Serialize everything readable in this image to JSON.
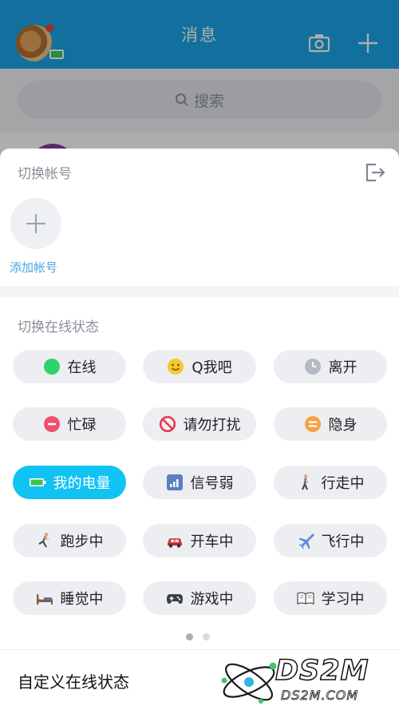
{
  "header": {
    "title": "消息"
  },
  "search": {
    "placeholder": "搜索"
  },
  "account_section": {
    "title": "切换帐号",
    "add_label": "添加帐号"
  },
  "status_section": {
    "title": "切换在线状态",
    "items": [
      {
        "label": "在线",
        "icon": "green-dot-icon",
        "active": false
      },
      {
        "label": "Q我吧",
        "icon": "smile-face-icon",
        "active": false
      },
      {
        "label": "离开",
        "icon": "clock-icon",
        "active": false
      },
      {
        "label": "忙碌",
        "icon": "minus-circle-icon",
        "active": false
      },
      {
        "label": "请勿打扰",
        "icon": "no-entry-icon",
        "active": false
      },
      {
        "label": "隐身",
        "icon": "equals-circle-icon",
        "active": false
      },
      {
        "label": "我的电量",
        "icon": "battery-icon",
        "active": true
      },
      {
        "label": "信号弱",
        "icon": "signal-icon",
        "active": false
      },
      {
        "label": "行走中",
        "icon": "walking-icon",
        "active": false
      },
      {
        "label": "跑步中",
        "icon": "running-icon",
        "active": false
      },
      {
        "label": "开车中",
        "icon": "car-icon",
        "active": false
      },
      {
        "label": "飞行中",
        "icon": "airplane-icon",
        "active": false
      },
      {
        "label": "睡觉中",
        "icon": "bed-icon",
        "active": false
      },
      {
        "label": "游戏中",
        "icon": "gamepad-icon",
        "active": false
      },
      {
        "label": "学习中",
        "icon": "book-icon",
        "active": false
      }
    ]
  },
  "pager": {
    "page_index": 1,
    "page_count": 2
  },
  "footer": {
    "custom_status_label": "自定义在线状态"
  },
  "watermark": {
    "text": "DS2M",
    "sub": "DS2M.COM"
  },
  "colors": {
    "accent": "#10c3f3",
    "header": "#1aa6e8",
    "link": "#4ba3e0"
  }
}
